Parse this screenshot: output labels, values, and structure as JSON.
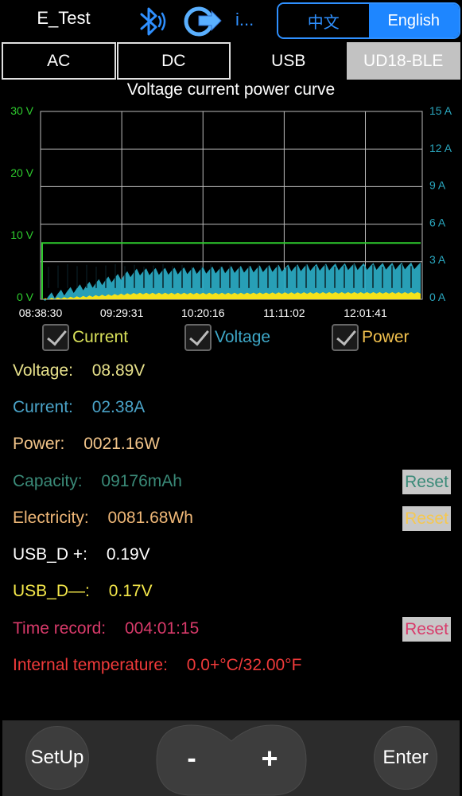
{
  "header": {
    "title": "E_Test",
    "info_label": "i...",
    "lang_cn": "中文",
    "lang_en": "English",
    "bt_icon": "bluetooth-icon",
    "sync_icon": "sync-icon"
  },
  "tabs": [
    {
      "label": "AC",
      "active": false
    },
    {
      "label": "DC",
      "active": false
    },
    {
      "label": "USB",
      "active": false
    },
    {
      "label": "UD18-BLE",
      "active": true
    }
  ],
  "chart_data": {
    "type": "line",
    "title": "Voltage current power curve",
    "x": [
      "08:38:30",
      "09:29:31",
      "10:20:16",
      "11:11:02",
      "12:01:41"
    ],
    "left_axis": {
      "ticks": [
        "30 V",
        "20 V",
        "10 V",
        "0 V"
      ],
      "ylim": [
        0,
        30
      ],
      "unit": "V"
    },
    "right_axis": {
      "ticks": [
        "15 A",
        "12 A",
        "9 A",
        "6 A",
        "3 A",
        "0 A"
      ],
      "ylim": [
        0,
        15
      ],
      "unit": "A"
    },
    "grid": true,
    "series": [
      {
        "name": "Voltage",
        "color": "#2ecc2e",
        "axis": "left",
        "values": [
          0.1,
          9.0,
          9.0,
          9.0,
          9.0
        ]
      },
      {
        "name": "Current",
        "color": "#2aa8c0",
        "axis": "right",
        "values": [
          0.0,
          2.1,
          2.3,
          2.5,
          2.6
        ]
      },
      {
        "name": "Power",
        "color": "#f5e21a",
        "axis": "left",
        "values": [
          0.0,
          0.9,
          0.9,
          1.0,
          1.0
        ]
      }
    ],
    "colors": {
      "voltage_axis": "#2ecc2e",
      "current_axis": "#2aa8c0"
    }
  },
  "legend": [
    {
      "label": "Current",
      "color": "#d8e05a",
      "checked": true
    },
    {
      "label": "Voltage",
      "color": "#3ea8c8",
      "checked": true
    },
    {
      "label": "Power",
      "color": "#f2c14e",
      "checked": true
    }
  ],
  "readouts": {
    "voltage": {
      "label": "Voltage:",
      "value": "08.89V",
      "color": "#e6e08a"
    },
    "current": {
      "label": "Current:",
      "value": "02.38A",
      "color": "#4aa3c8"
    },
    "power": {
      "label": "Power:",
      "value": "0021.16W",
      "color": "#f2c58a"
    },
    "capacity": {
      "label": "Capacity:",
      "value": "09176mAh",
      "color": "#3a8a78"
    },
    "electricity": {
      "label": "Electricity:",
      "value": "0081.68Wh",
      "color": "#f0b878"
    },
    "usb_dp": {
      "label": "USB_D +:",
      "value": "0.19V",
      "color": "#ffffff"
    },
    "usb_dm": {
      "label": "USB_D—:",
      "value": "0.17V",
      "color": "#f5e84a"
    },
    "time_record": {
      "label": "Time record:",
      "value": "004:01:15",
      "color": "#d83a6a"
    },
    "temperature": {
      "label": "Internal temperature:",
      "value": "0.0+°C/32.00°F",
      "color": "#f03a3a"
    }
  },
  "reset_label": "Reset",
  "reset_colors": {
    "capacity": "#3a8a78",
    "electricity": "#f5c850",
    "time": "#d83a6a"
  },
  "bottom": {
    "setup": "SetUp",
    "minus": "-",
    "plus": "+",
    "enter": "Enter"
  }
}
